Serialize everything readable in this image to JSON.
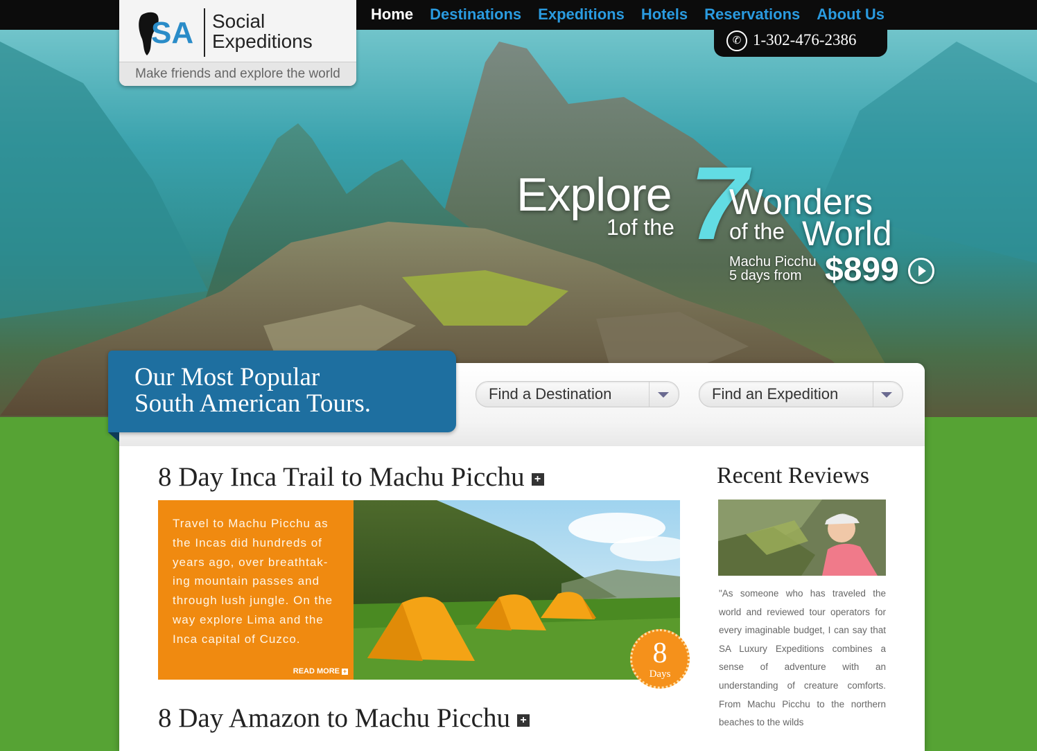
{
  "header": {
    "logo_initials": "SA",
    "logo_name_line1": "Social",
    "logo_name_line2": "Expeditions",
    "tagline": "Make friends and explore the world",
    "phone": "1-302-476-2386",
    "nav": [
      {
        "label": "Home",
        "active": true
      },
      {
        "label": "Destinations",
        "active": false
      },
      {
        "label": "Expeditions",
        "active": false
      },
      {
        "label": "Hotels",
        "active": false
      },
      {
        "label": "Reservations",
        "active": false
      },
      {
        "label": "About Us",
        "active": false
      }
    ]
  },
  "promo": {
    "explore": "Explore",
    "one_of_the": "1of the",
    "seven": "7",
    "wonders": "Wonders",
    "of_the": "of the",
    "world": "World",
    "place": "Machu Picchu",
    "days_from": "5 days from",
    "price": "$899"
  },
  "tours_section": {
    "title_line1": "Our Most Popular",
    "title_line2": "South American Tours.",
    "dropdowns": [
      "Find a Destination",
      "Find an Expedition"
    ]
  },
  "tours": [
    {
      "title": "8 Day Inca Trail to Machu Picchu",
      "description": "Travel to Machu Picchu as the Incas did hundreds of years ago, over breathtak-ing mountain passes and through lush jungle. On the way explore Lima and the Inca capital of Cuzco.",
      "read_more": "READ MORE",
      "days_number": "8",
      "days_label": "Days"
    },
    {
      "title": "8 Day Amazon to Machu Picchu"
    }
  ],
  "reviews": {
    "title": "Recent Reviews",
    "text": "\"As someone who has traveled the world and reviewed tour operators for every imaginable budget, I can say that SA Luxury Expeditions combines a sense of adventure with an understanding of creature comforts. From Machu Picchu to the northern beaches to the wilds"
  },
  "colors": {
    "nav_link": "#2a9be0",
    "tab_blue": "#1e6fa0",
    "orange": "#f08a10",
    "green_bg": "#56a334",
    "accent_cyan": "#62dce3"
  },
  "icons": [
    "phone-icon",
    "play-circle-icon",
    "chevron-down-icon",
    "plus-icon"
  ]
}
